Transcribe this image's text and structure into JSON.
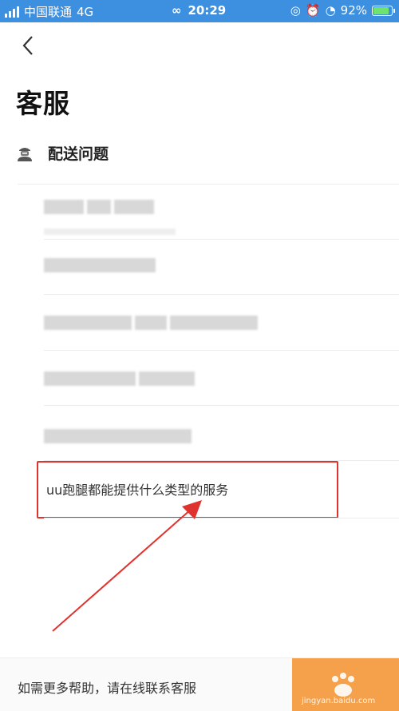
{
  "status_bar": {
    "carrier": "中国联通",
    "network": "4G",
    "time": "20:29",
    "battery": "92%",
    "battery_level": 0.92
  },
  "page": {
    "title": "客服"
  },
  "section": {
    "label": "配送问题"
  },
  "highlighted_question": {
    "text": "uu跑腿都能提供什么类型的服务"
  },
  "footer": {
    "help_text": "如需更多帮助，请在线联系客服",
    "watermark": "jingyan.baidu.com"
  },
  "colors": {
    "status_bar": "#3d8fe0",
    "highlight_border": "#e0332f",
    "arrow": "#e0332f",
    "contact_button": "#f5a04a"
  }
}
